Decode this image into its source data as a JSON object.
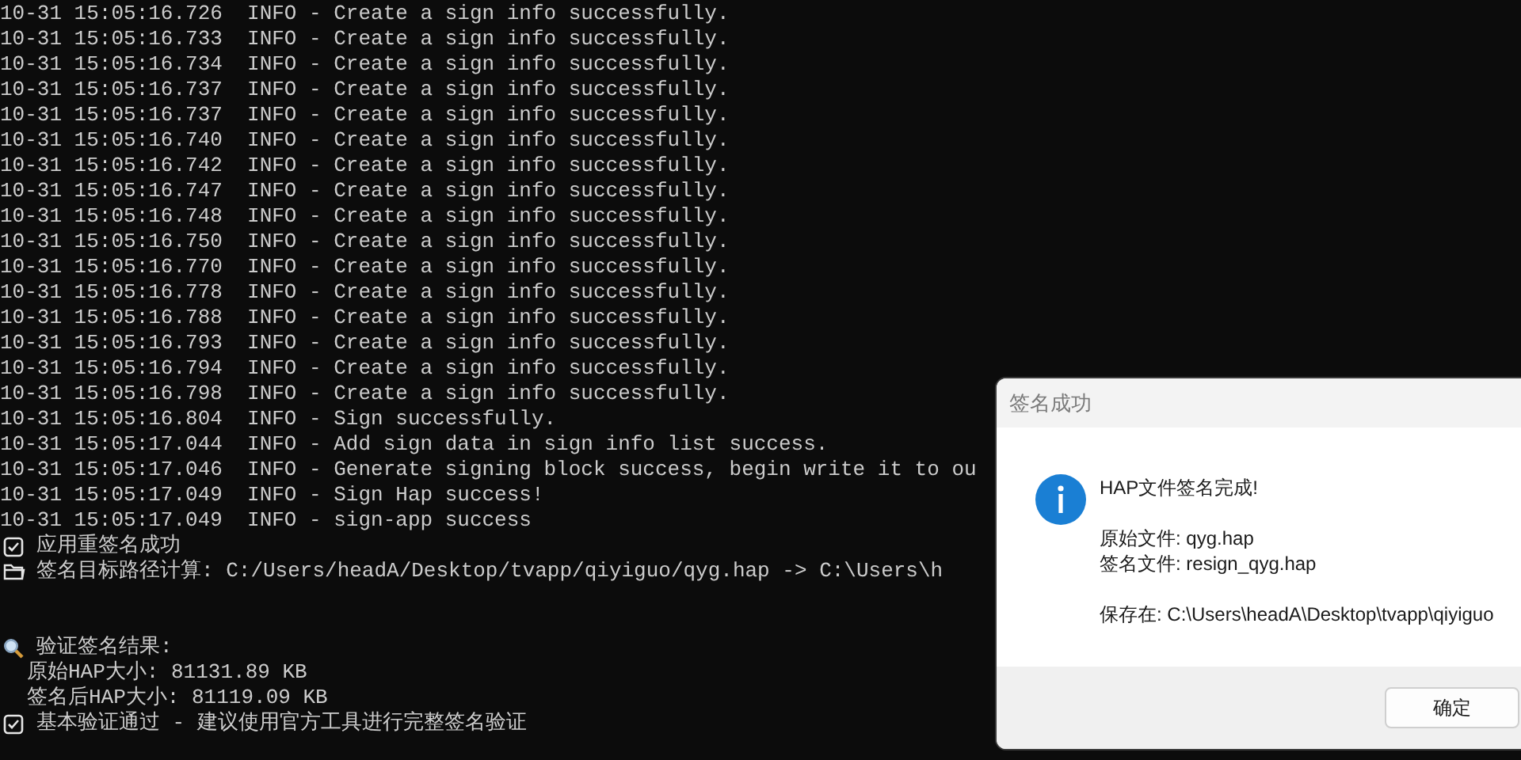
{
  "console": {
    "lines": [
      {
        "kind": "log",
        "text": "10-31 15:05:16.726  INFO - Create a sign info successfully."
      },
      {
        "kind": "log",
        "text": "10-31 15:05:16.733  INFO - Create a sign info successfully."
      },
      {
        "kind": "log",
        "text": "10-31 15:05:16.734  INFO - Create a sign info successfully."
      },
      {
        "kind": "log",
        "text": "10-31 15:05:16.737  INFO - Create a sign info successfully."
      },
      {
        "kind": "log",
        "text": "10-31 15:05:16.737  INFO - Create a sign info successfully."
      },
      {
        "kind": "log",
        "text": "10-31 15:05:16.740  INFO - Create a sign info successfully."
      },
      {
        "kind": "log",
        "text": "10-31 15:05:16.742  INFO - Create a sign info successfully."
      },
      {
        "kind": "log",
        "text": "10-31 15:05:16.747  INFO - Create a sign info successfully."
      },
      {
        "kind": "log",
        "text": "10-31 15:05:16.748  INFO - Create a sign info successfully."
      },
      {
        "kind": "log",
        "text": "10-31 15:05:16.750  INFO - Create a sign info successfully."
      },
      {
        "kind": "log",
        "text": "10-31 15:05:16.770  INFO - Create a sign info successfully."
      },
      {
        "kind": "log",
        "text": "10-31 15:05:16.778  INFO - Create a sign info successfully."
      },
      {
        "kind": "log",
        "text": "10-31 15:05:16.788  INFO - Create a sign info successfully."
      },
      {
        "kind": "log",
        "text": "10-31 15:05:16.793  INFO - Create a sign info successfully."
      },
      {
        "kind": "log",
        "text": "10-31 15:05:16.794  INFO - Create a sign info successfully."
      },
      {
        "kind": "log",
        "text": "10-31 15:05:16.798  INFO - Create a sign info successfully."
      },
      {
        "kind": "log",
        "text": "10-31 15:05:16.804  INFO - Sign successfully."
      },
      {
        "kind": "log",
        "text": "10-31 15:05:17.044  INFO - Add sign data in sign info list success."
      },
      {
        "kind": "log",
        "text": "10-31 15:05:17.046  INFO - Generate signing block success, begin write it to ou"
      },
      {
        "kind": "log",
        "text": "10-31 15:05:17.049  INFO - Sign Hap success!"
      },
      {
        "kind": "log",
        "text": "10-31 15:05:17.049  INFO - sign-app success"
      },
      {
        "kind": "check",
        "text": "应用重签名成功"
      },
      {
        "kind": "folder",
        "text": "签名目标路径计算: C:/Users/headA/Desktop/tvapp/qiyiguo/qyg.hap -> C:\\Users\\h"
      },
      {
        "kind": "blank"
      },
      {
        "kind": "blank"
      },
      {
        "kind": "search",
        "text": "验证签名结果:"
      },
      {
        "kind": "indent",
        "text": "原始HAP大小: 81131.89 KB"
      },
      {
        "kind": "indent",
        "text": "签名后HAP大小: 81119.09 KB"
      },
      {
        "kind": "check",
        "text": "基本验证通过 - 建议使用官方工具进行完整签名验证"
      }
    ]
  },
  "dialog": {
    "title": "签名成功",
    "paragraphs": [
      [
        "HAP文件签名完成!"
      ],
      [
        "原始文件: qyg.hap",
        "签名文件: resign_qyg.hap"
      ],
      [
        "保存在: C:\\Users\\headA\\Desktop\\tvapp\\qiyiguo"
      ]
    ],
    "button": "确定"
  }
}
